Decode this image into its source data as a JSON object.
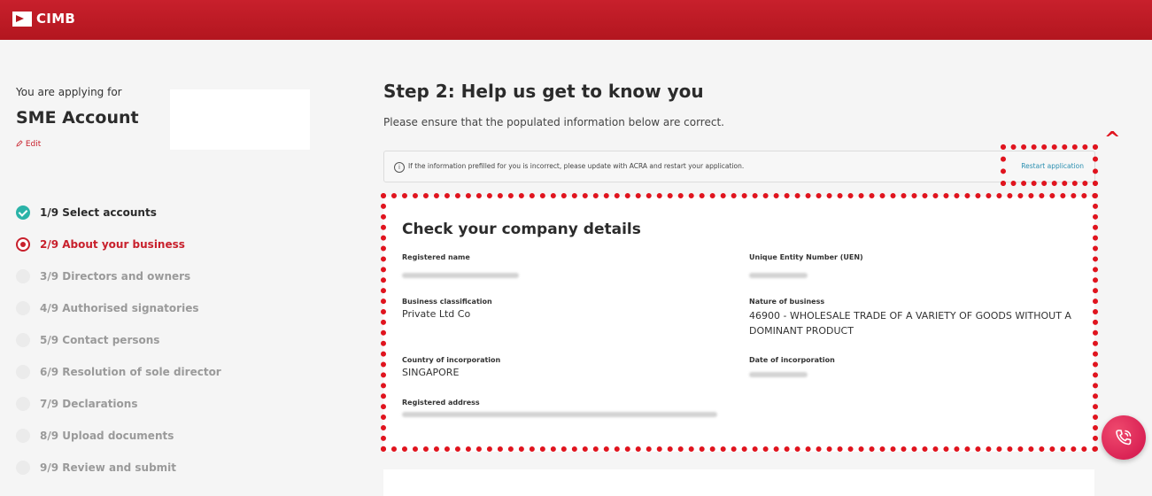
{
  "header": {
    "brand": "CIMB",
    "color": "#b3161f"
  },
  "sidebar": {
    "applying_label": "You are applying for",
    "product": "SME Account",
    "edit_label": "Edit",
    "steps": [
      {
        "label": "1/9 Select accounts",
        "status": "done"
      },
      {
        "label": "2/9 About your business",
        "status": "active"
      },
      {
        "label": "3/9 Directors and owners",
        "status": "pending"
      },
      {
        "label": "4/9 Authorised signatories",
        "status": "pending"
      },
      {
        "label": "5/9 Contact persons",
        "status": "pending"
      },
      {
        "label": "6/9 Resolution of sole director",
        "status": "pending"
      },
      {
        "label": "7/9 Declarations",
        "status": "pending"
      },
      {
        "label": "8/9 Upload documents",
        "status": "pending"
      },
      {
        "label": "9/9 Review and submit",
        "status": "pending"
      }
    ]
  },
  "main": {
    "title": "Step 2: Help us get to know you",
    "subtitle": "Please ensure that the populated information below are correct.",
    "notice": {
      "icon": "info-icon",
      "text": "If the information prefilled for you is incorrect, please update with ACRA and restart your application.",
      "link": "Restart application"
    },
    "annotation_caret": "^",
    "company": {
      "title": "Check your company details",
      "fields": {
        "registered_name": {
          "label": "Registered name"
        },
        "uen": {
          "label": "Unique Entity Number (UEN)"
        },
        "business_classification": {
          "label": "Business classification",
          "value": "Private Ltd Co"
        },
        "nature_of_business": {
          "label": "Nature of business",
          "value": "46900 - WHOLESALE TRADE OF A VARIETY OF GOODS WITHOUT A DOMINANT PRODUCT"
        },
        "country": {
          "label": "Country of incorporation",
          "value": "SINGAPORE"
        },
        "date": {
          "label": "Date of incorporation"
        },
        "address": {
          "label": "Registered address"
        }
      }
    }
  },
  "highlight_color": "#e0141e",
  "accent_color": "#c8202c",
  "done_color": "#2bb3a8"
}
